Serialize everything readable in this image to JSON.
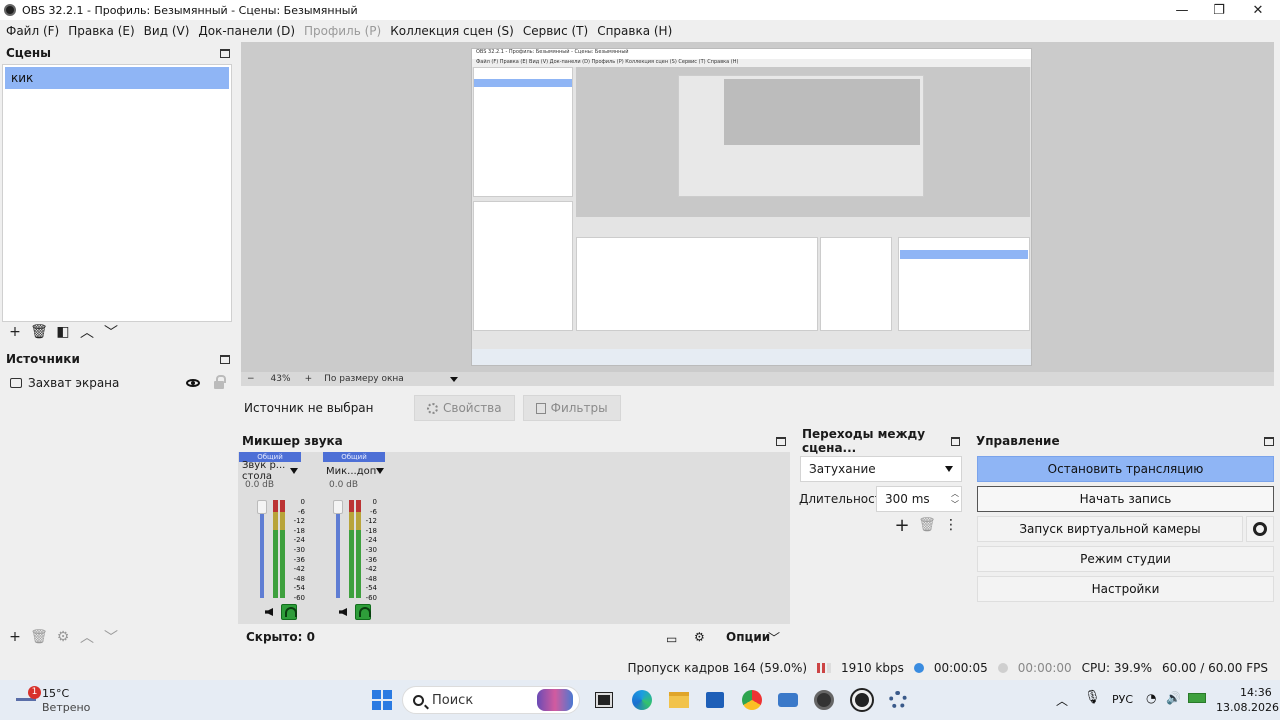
{
  "window": {
    "title": "OBS 32.2.1 - Профиль: Безымянный - Сцены: Безымянный",
    "minimize": "—",
    "maximize": "❐",
    "close": "✕"
  },
  "menu": {
    "file": "Файл (F)",
    "edit": "Правка (E)",
    "view": "Вид (V)",
    "docks": "Док-панели (D)",
    "profile": "Профиль (P)",
    "scene_collection": "Коллекция сцен (S)",
    "tools": "Сервис (T)",
    "help": "Справка (H)"
  },
  "scenes": {
    "title": "Сцены",
    "items": [
      "кик"
    ]
  },
  "sources": {
    "title": "Источники",
    "items": [
      "Захват экрана"
    ]
  },
  "preview": {
    "zoom": "43%",
    "zoom_minus": "−",
    "zoom_plus": "+",
    "fit_mode": "По размеру окна"
  },
  "source_bar": {
    "no_source": "Источник не выбран",
    "properties": "Свойства",
    "filters": "Фильтры"
  },
  "mixer": {
    "title": "Микшер звука",
    "channels": [
      {
        "tab": "Общий",
        "name": "Звук р... стола",
        "db": "0.0 dB"
      },
      {
        "tab": "Общий",
        "name": "Мик...доп",
        "db": "0.0 dB"
      }
    ],
    "scale": [
      "0",
      "-6",
      "-12",
      "-18",
      "-24",
      "-30",
      "-36",
      "-42",
      "-48",
      "-54",
      "-60"
    ],
    "hidden": "Скрыто: 0",
    "options": "Опции"
  },
  "transitions": {
    "title": "Переходы между сцена...",
    "selected": "Затухание",
    "duration_label": "Длительность",
    "duration_value": "300 ms"
  },
  "controls": {
    "title": "Управление",
    "stop_stream": "Остановить трансляцию",
    "start_record": "Начать запись",
    "virtual_cam": "Запуск виртуальной камеры",
    "studio_mode": "Режим студии",
    "settings": "Настройки"
  },
  "status": {
    "dropped_frames": "Пропуск кадров 164 (59.0%)",
    "bitrate": "1910 kbps",
    "stream_time": "00:00:05",
    "record_time": "00:00:00",
    "cpu": "CPU: 39.9%",
    "fps": "60.00 / 60.00 FPS"
  },
  "taskbar": {
    "weather_temp": "15°C",
    "weather_desc": "Ветрено",
    "weather_badge": "1",
    "search": "Поиск",
    "language": "РУС",
    "time": "14:36",
    "date": "13.08.2026"
  },
  "mini_preview": {
    "title": "OBS 32.2.1 - Профиль: Безымянный - Сцены: Безымянный",
    "menu": "Файл (F)   Правка (E)   Вид (V)   Док-панели (D)   Профиль (P)   Коллекция сцен (S)   Сервис (T)   Справка (H)"
  },
  "colors": {
    "accent_blue": "#8fb5f5",
    "mixer_tab": "#4d6fd6",
    "monitor_green": "#2e9d3a"
  }
}
